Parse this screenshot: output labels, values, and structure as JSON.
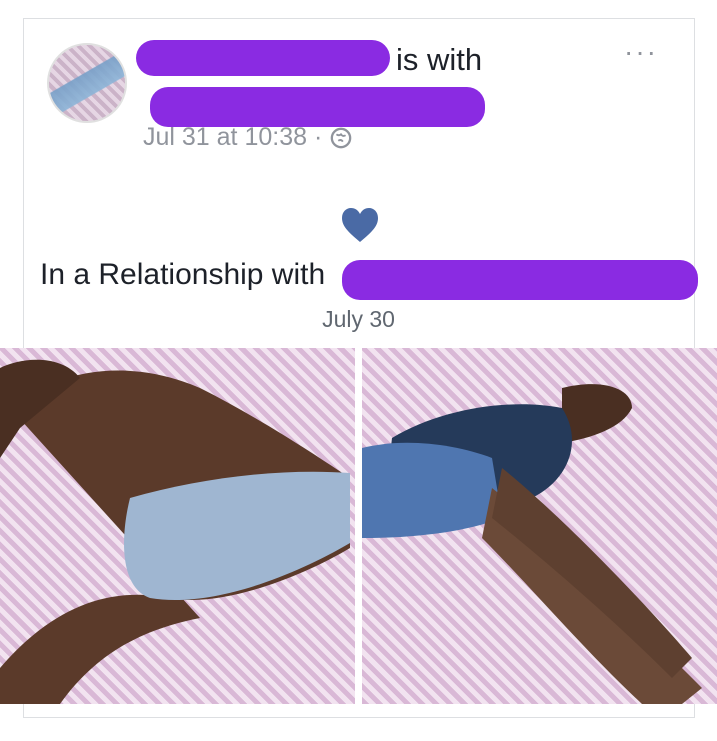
{
  "post": {
    "is_with": "is with",
    "timestamp": "Jul 31 at 10:38 ·",
    "privacy_icon": "globe-icon",
    "more_icon": "more-icon",
    "more_label": "···"
  },
  "life_event": {
    "icon": "heart-icon",
    "heart_color": "#4a6aa5",
    "title": "In a Relationship with",
    "date": "July 30"
  },
  "colors": {
    "redaction": "#8a2be2",
    "text_primary": "#1d2129",
    "text_secondary": "#90949c"
  }
}
